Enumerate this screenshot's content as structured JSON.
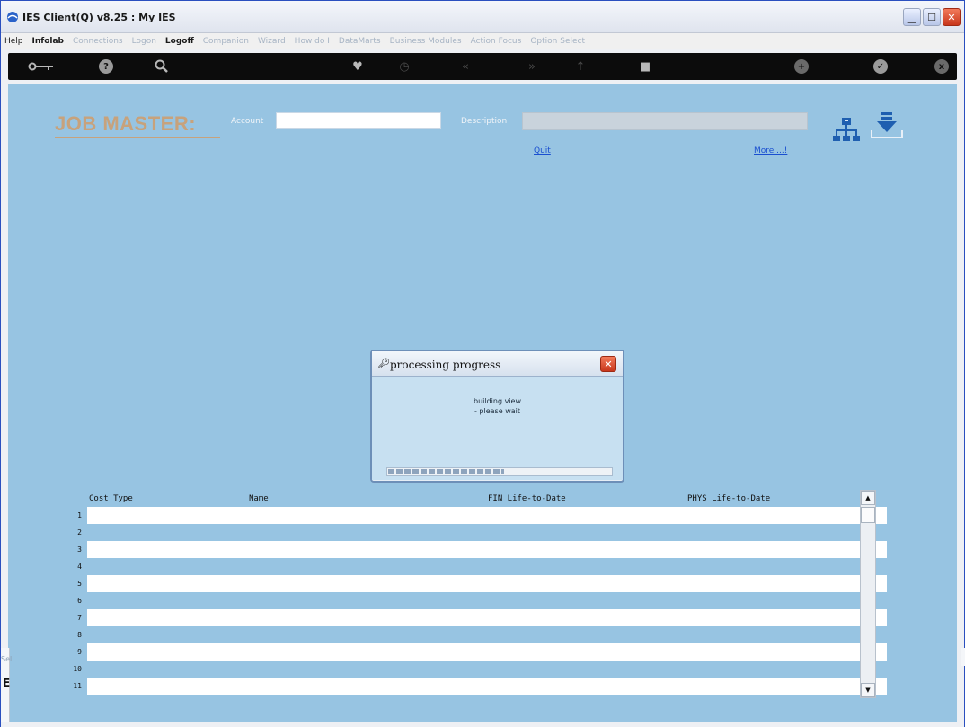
{
  "window": {
    "title": "IES Client(Q) v8.25 : My IES"
  },
  "menu": {
    "items": [
      {
        "label": "Help",
        "state": "help"
      },
      {
        "label": "Infolab",
        "state": "on"
      },
      {
        "label": "Connections",
        "state": "off"
      },
      {
        "label": "Logon",
        "state": "off"
      },
      {
        "label": "Logoff",
        "state": "on"
      },
      {
        "label": "Companion",
        "state": "off"
      },
      {
        "label": "Wizard",
        "state": "off"
      },
      {
        "label": "How do I",
        "state": "off"
      },
      {
        "label": "DataMarts",
        "state": "off"
      },
      {
        "label": "Business Modules",
        "state": "off"
      },
      {
        "label": "Action Focus",
        "state": "off"
      },
      {
        "label": "Option Select",
        "state": "off"
      }
    ]
  },
  "toolbar": {
    "icons": [
      "key-icon",
      "help-icon",
      "search-icon",
      "heart-icon",
      "clock-icon",
      "rewind-icon",
      "fast-forward-icon",
      "step-icon",
      "stop-icon",
      "plus-icon",
      "check-icon",
      "close-icon"
    ]
  },
  "form": {
    "title": "JOB MASTER:",
    "account_label": "Account",
    "account_value": "",
    "description_label": "Description",
    "description_value": "",
    "quit_link": "Quit",
    "more_link": "More ...!"
  },
  "dialog": {
    "title": "processing progress",
    "message_line1": "building view",
    "message_line2": "- please wait",
    "progress": 0.52
  },
  "grid": {
    "columns": [
      "Cost Type",
      "Name",
      "FIN Life-to-Date",
      "PHYS Life-to-Date"
    ],
    "row_numbers": [
      "1",
      "2",
      "3",
      "4",
      "5",
      "6",
      "7",
      "8",
      "9",
      "10",
      "11"
    ]
  },
  "left_edge": {
    "partial_label": "Sel",
    "partial_glyph": "E"
  },
  "colors": {
    "main_bg": "#97c4e2",
    "title_tan": "#c7a27c",
    "link_blue": "#1a4fd0",
    "toolbar_bg": "#0c0c0c"
  }
}
